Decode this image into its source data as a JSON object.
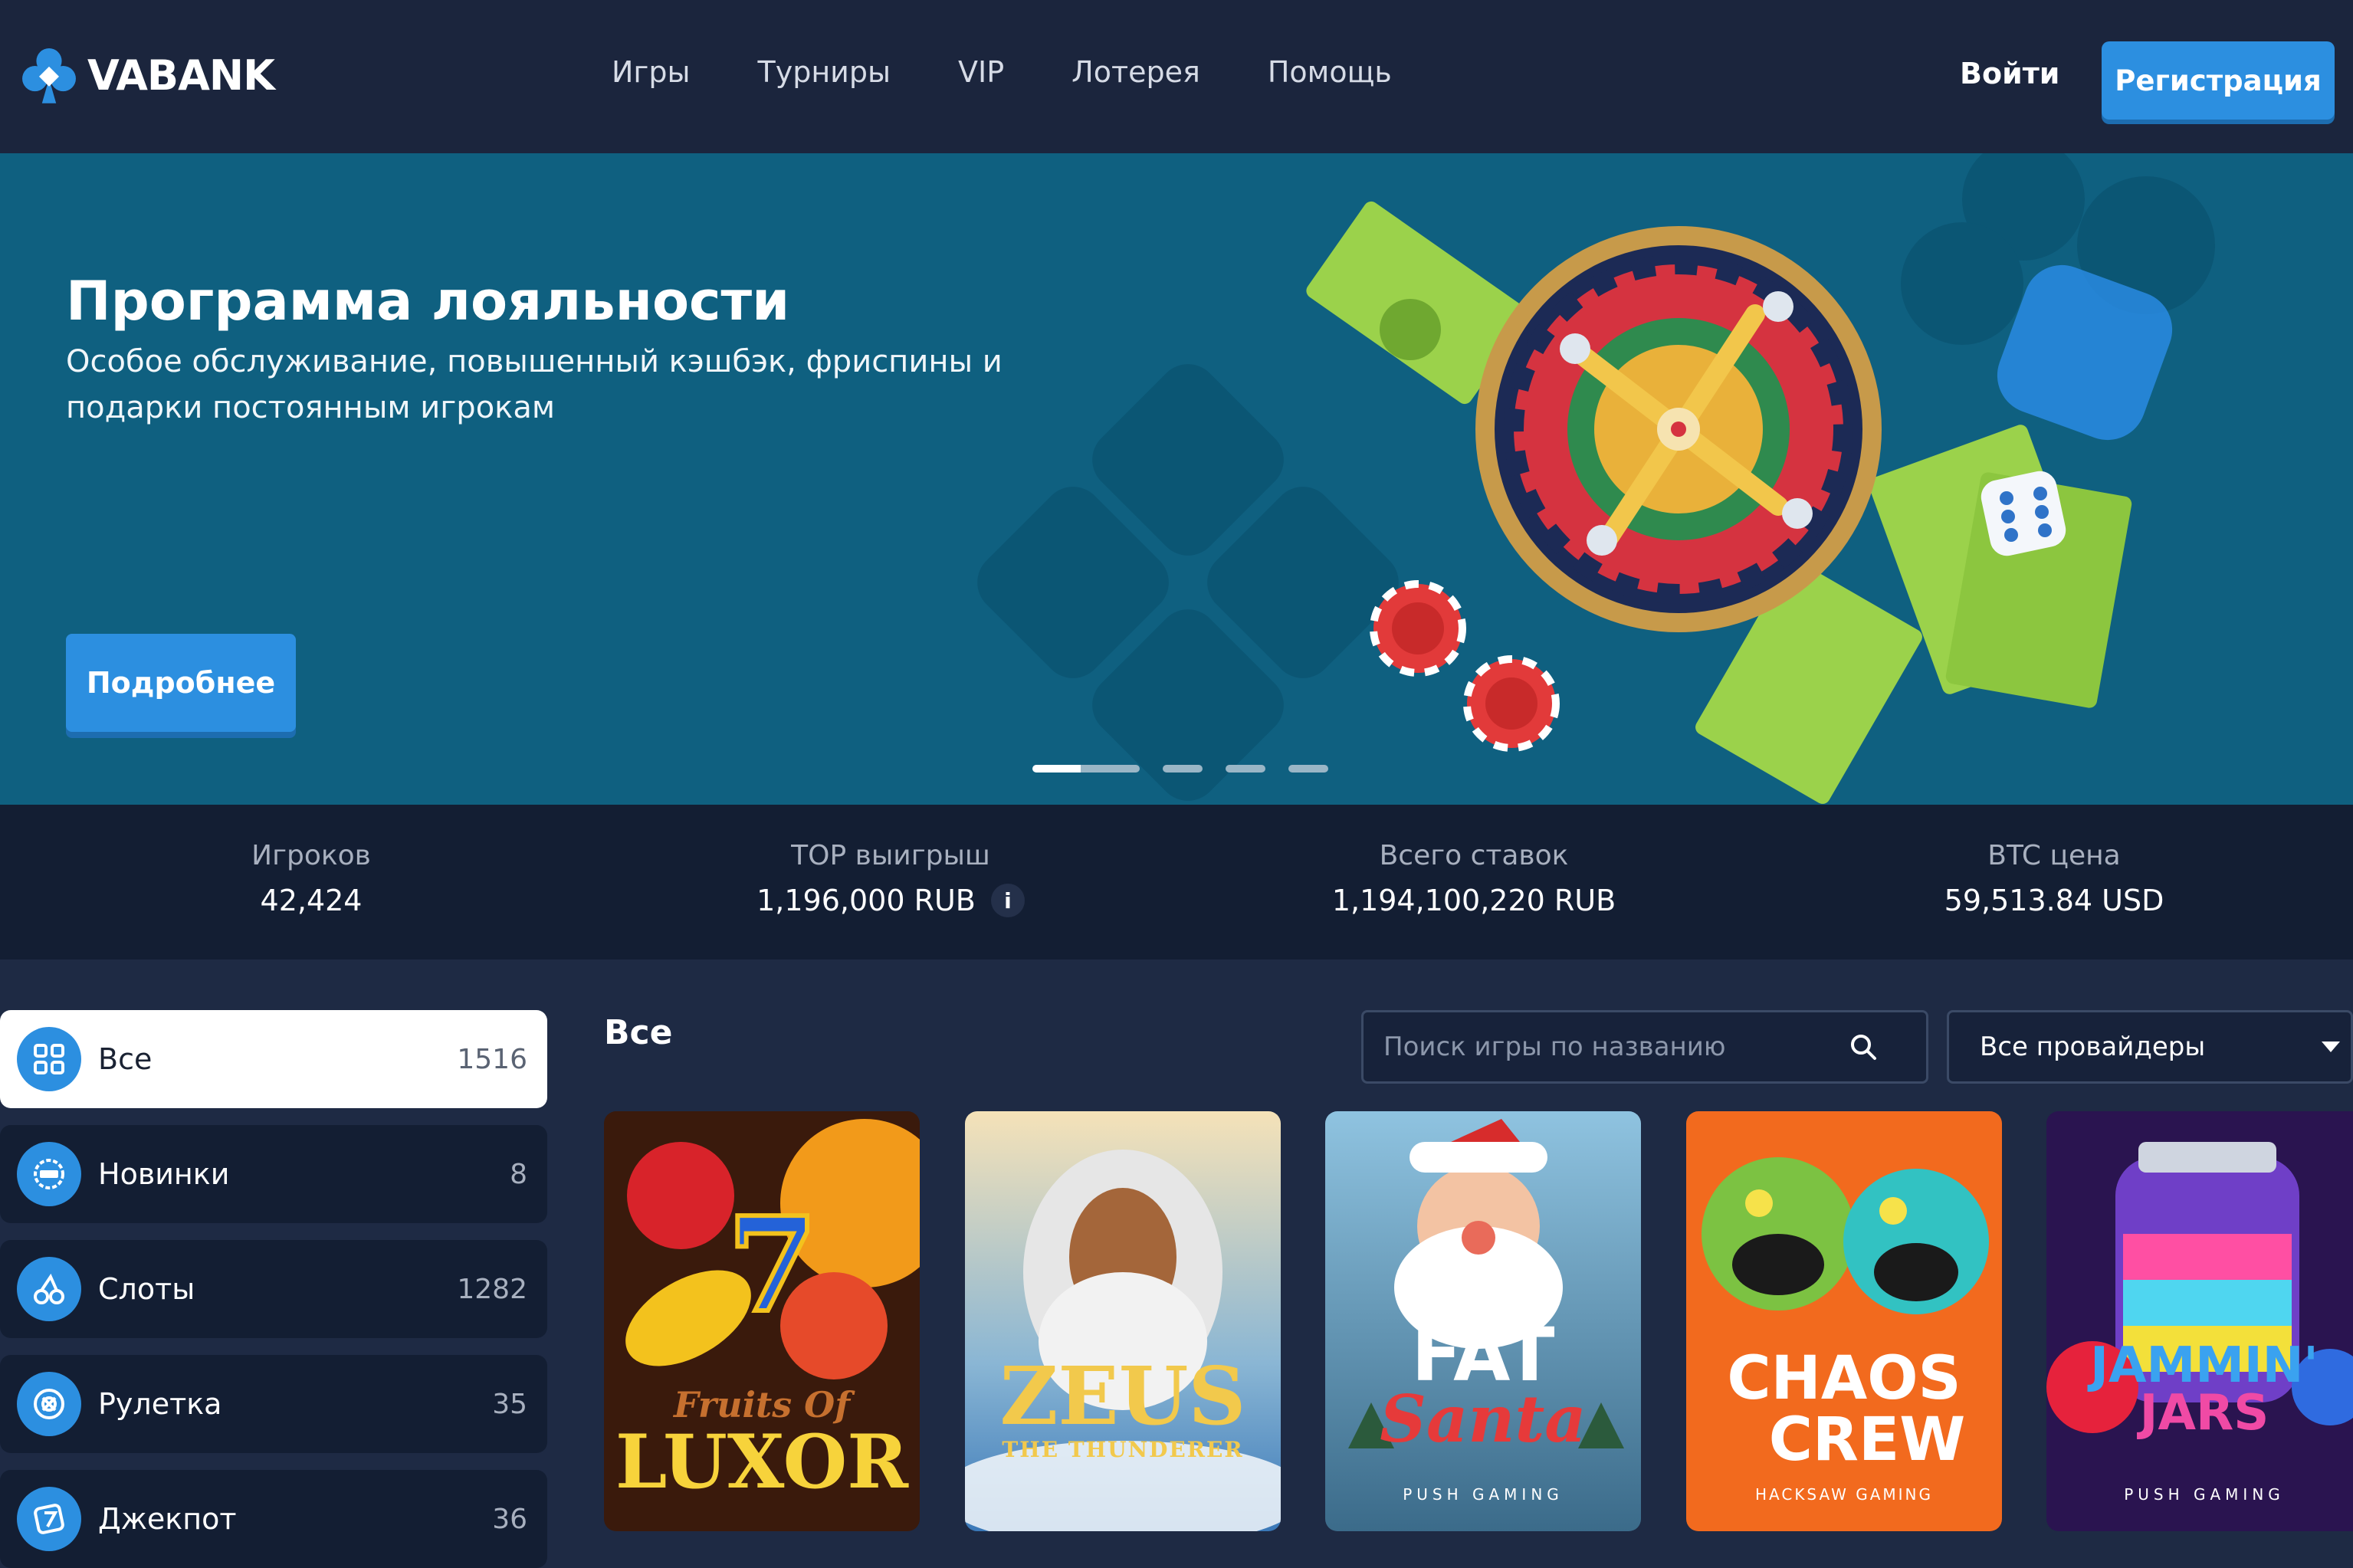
{
  "header": {
    "brand": "VABANK",
    "nav": [
      "Игры",
      "Турниры",
      "VIP",
      "Лотерея",
      "Помощь"
    ],
    "login_label": "Войти",
    "register_label": "Регистрация"
  },
  "banner": {
    "title": "Программа лояльности",
    "subtitle": "Особое обслуживание, повышенный кэшбэк, фриспины и подарки постоянным игрокам",
    "button_label": "Подробнее",
    "slides_total": 4,
    "active_slide": 1
  },
  "stats": [
    {
      "label": "Игроков",
      "value": "42,424"
    },
    {
      "label": "TOP выигрыш",
      "value": "1,196,000 RUB"
    },
    {
      "label": "Всего ставок",
      "value": "1,194,100,220 RUB"
    },
    {
      "label": "BTC цена",
      "value": "59,513.84 USD"
    }
  ],
  "stats_info_icon": "i",
  "categories": [
    {
      "label": "Все",
      "count": "1516",
      "icon": "grid-icon",
      "active": true
    },
    {
      "label": "Новинки",
      "count": "8",
      "icon": "new-badge-icon",
      "active": false
    },
    {
      "label": "Слоты",
      "count": "1282",
      "icon": "cherry-icon",
      "active": false
    },
    {
      "label": "Рулетка",
      "count": "35",
      "icon": "roulette-icon",
      "active": false
    },
    {
      "label": "Джекпот",
      "count": "36",
      "icon": "jackpot-seven-icon",
      "active": false
    }
  ],
  "games_section": {
    "title": "Все",
    "search_placeholder": "Поиск игры по названию",
    "provider_select": "Все провайдеры"
  },
  "games": [
    {
      "title_line1": "Fruits Of",
      "title_line2": "LUXOR",
      "provider": ""
    },
    {
      "title_line1": "ZEUS",
      "title_line2": "THE THUNDERER",
      "provider": ""
    },
    {
      "title_line1": "FAT",
      "title_line2": "Santa",
      "provider": "PUSH GAMING"
    },
    {
      "title_line1": "CHAOS",
      "title_line2": "CREW",
      "provider": "HACKSAW GAMING"
    },
    {
      "title_line1": "JAMMIN'",
      "title_line2": "JARS",
      "provider": "PUSH GAMING"
    }
  ],
  "colors": {
    "accent": "#2c8fe0",
    "header_bg": "#1b253d",
    "banner_bg": "#0f6080",
    "stats_bg": "#131e33"
  }
}
